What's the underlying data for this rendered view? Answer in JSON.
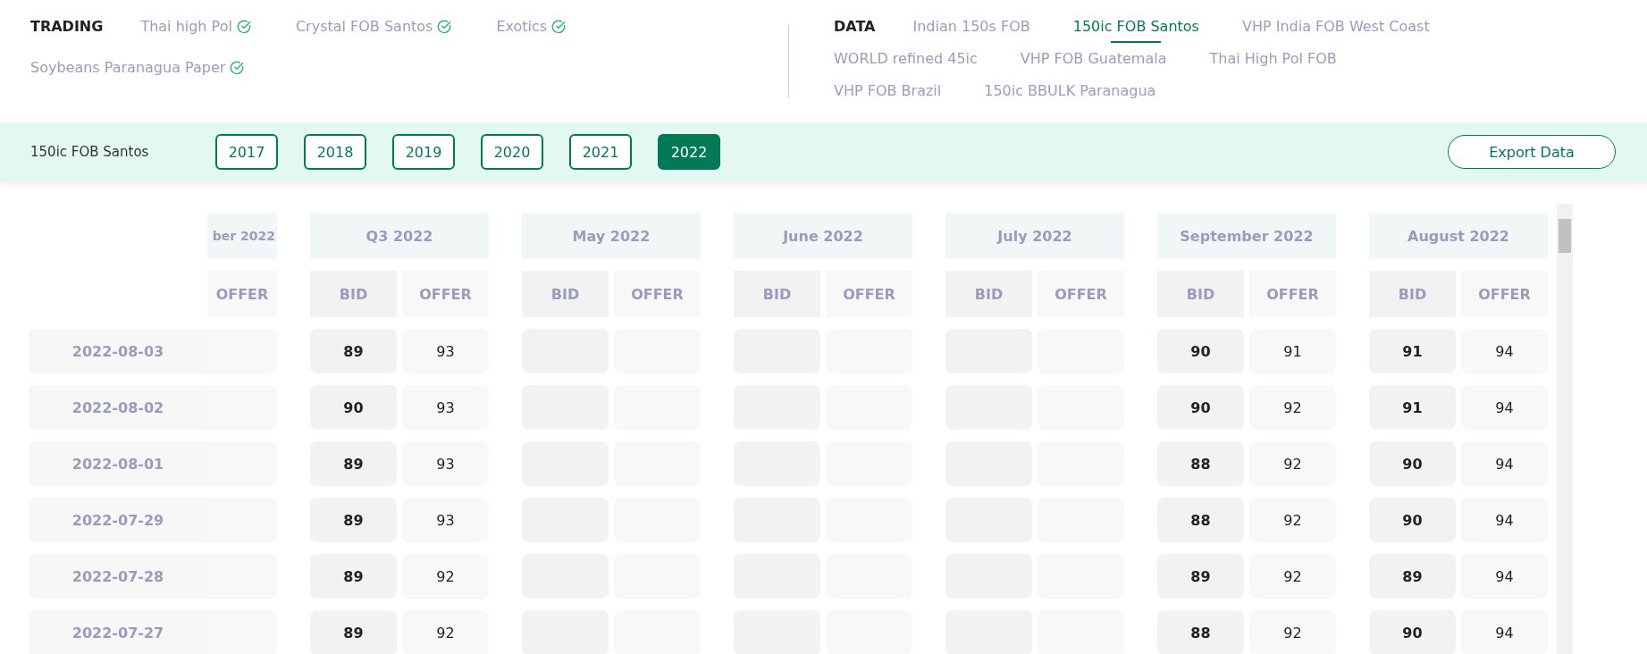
{
  "trading": {
    "label": "TRADING",
    "items": [
      {
        "label": "Thai high Pol",
        "checked": true
      },
      {
        "label": "Crystal FOB Santos",
        "checked": true
      },
      {
        "label": "Exotics",
        "checked": true
      },
      {
        "label": "Soybeans Paranagua Paper",
        "checked": true
      }
    ]
  },
  "data": {
    "label": "DATA",
    "items": [
      {
        "label": "Indian 150s FOB",
        "selected": false
      },
      {
        "label": "150ic FOB Santos",
        "selected": true
      },
      {
        "label": "VHP India FOB West Coast",
        "selected": false
      },
      {
        "label": "WORLD refined 45ic",
        "selected": false
      },
      {
        "label": "VHP FOB Guatemala",
        "selected": false
      },
      {
        "label": "Thai High Pol FOB",
        "selected": false
      },
      {
        "label": "VHP FOB Brazil",
        "selected": false
      },
      {
        "label": "150ic BBULK Paranagua",
        "selected": false
      }
    ]
  },
  "filter_bar": {
    "title": "150ic FOB Santos",
    "years": [
      {
        "label": "2017",
        "selected": false
      },
      {
        "label": "2018",
        "selected": false
      },
      {
        "label": "2019",
        "selected": false
      },
      {
        "label": "2020",
        "selected": false
      },
      {
        "label": "2021",
        "selected": false
      },
      {
        "label": "2022",
        "selected": true
      }
    ],
    "export_button": "Export Data"
  },
  "table": {
    "dates": [
      "2022-08-03",
      "2022-08-02",
      "2022-08-01",
      "2022-07-29",
      "2022-07-28",
      "2022-07-27"
    ],
    "columns": [
      {
        "title": "ber 2022",
        "kind": "partial",
        "sub": [
          {
            "label": "OFFER",
            "kind": "offer"
          }
        ]
      },
      {
        "title": "Q3 2022",
        "kind": "full",
        "sub": [
          {
            "label": "BID",
            "kind": "bid"
          },
          {
            "label": "OFFER",
            "kind": "offer"
          }
        ],
        "cells": [
          {
            "bid": "89",
            "offer": "93"
          },
          {
            "bid": "90",
            "offer": "93"
          },
          {
            "bid": "89",
            "offer": "93"
          },
          {
            "bid": "89",
            "offer": "93"
          },
          {
            "bid": "89",
            "offer": "92"
          },
          {
            "bid": "89",
            "offer": "92"
          }
        ]
      },
      {
        "title": "May 2022",
        "kind": "full",
        "sub": [
          {
            "label": "BID",
            "kind": "bid"
          },
          {
            "label": "OFFER",
            "kind": "offer"
          }
        ]
      },
      {
        "title": "June 2022",
        "kind": "full",
        "sub": [
          {
            "label": "BID",
            "kind": "bid"
          },
          {
            "label": "OFFER",
            "kind": "offer"
          }
        ]
      },
      {
        "title": "July 2022",
        "kind": "full",
        "sub": [
          {
            "label": "BID",
            "kind": "bid"
          },
          {
            "label": "OFFER",
            "kind": "offer"
          }
        ]
      },
      {
        "title": "September 2022",
        "kind": "full",
        "sub": [
          {
            "label": "BID",
            "kind": "bid"
          },
          {
            "label": "OFFER",
            "kind": "offer"
          }
        ],
        "cells": [
          {
            "bid": "90",
            "offer": "91"
          },
          {
            "bid": "90",
            "offer": "92"
          },
          {
            "bid": "88",
            "offer": "92"
          },
          {
            "bid": "88",
            "offer": "92"
          },
          {
            "bid": "89",
            "offer": "92"
          },
          {
            "bid": "88",
            "offer": "92"
          }
        ]
      },
      {
        "title": "August 2022",
        "kind": "full",
        "sub": [
          {
            "label": "BID",
            "kind": "bid"
          },
          {
            "label": "OFFER",
            "kind": "offer"
          }
        ],
        "cells": [
          {
            "bid": "91",
            "offer": "94"
          },
          {
            "bid": "91",
            "offer": "94"
          },
          {
            "bid": "90",
            "offer": "94"
          },
          {
            "bid": "90",
            "offer": "94"
          },
          {
            "bid": "89",
            "offer": "94"
          },
          {
            "bid": "90",
            "offer": "94"
          }
        ]
      }
    ]
  }
}
